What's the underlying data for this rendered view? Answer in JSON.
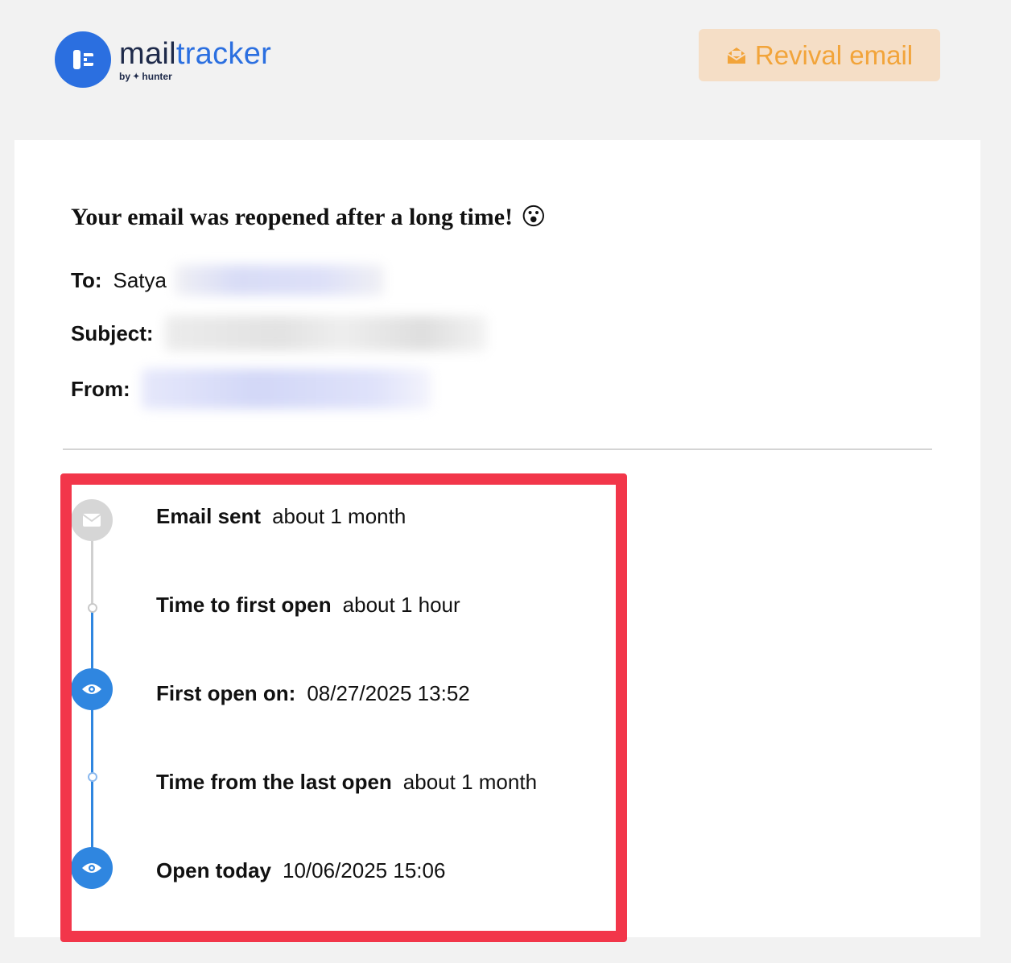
{
  "header": {
    "brand_prefix": "mail",
    "brand_suffix": "tracker",
    "byline_by": "by",
    "byline_company": "hunter",
    "revival_button_label": "Revival email"
  },
  "email": {
    "headline": "Your email was reopened after a long time!",
    "headline_emoji": "😮",
    "to_label": "To:",
    "to_value": "Satya",
    "subject_label": "Subject:",
    "from_label": "From:"
  },
  "timeline": [
    {
      "label": "Email sent",
      "value": "about 1 month",
      "icon": "envelope-icon",
      "kind": "icon",
      "color": "#d6d6d6"
    },
    {
      "label": "Time to first open",
      "value": "about 1 hour",
      "icon": "dot",
      "kind": "dot"
    },
    {
      "label": "First open on:",
      "value": "08/27/2025 13:52",
      "icon": "eye-icon",
      "kind": "icon",
      "color": "#2f86e0"
    },
    {
      "label": "Time from the last open",
      "value": "about 1 month",
      "icon": "dot",
      "kind": "dot"
    },
    {
      "label": "Open today",
      "value": "10/06/2025 15:06",
      "icon": "eye-icon",
      "kind": "icon",
      "color": "#2f86e0"
    }
  ],
  "colors": {
    "brand_blue": "#2b6fe0",
    "revival_bg": "#f5dec6",
    "revival_text": "#f2a43a",
    "highlight_red": "#f2364a",
    "timeline_blue": "#2f86e0",
    "timeline_grey": "#d6d6d6"
  }
}
